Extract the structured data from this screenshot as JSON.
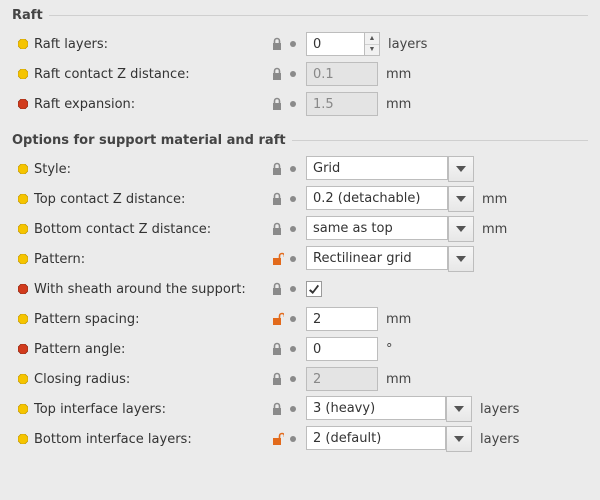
{
  "raft": {
    "title": "Raft",
    "rows": {
      "layers": {
        "label": "Raft layers:",
        "value": "0",
        "unit": "layers",
        "bullet": "yellow",
        "lock": "closed"
      },
      "contact_z": {
        "label": "Raft contact Z distance:",
        "value": "0.1",
        "unit": "mm",
        "bullet": "yellow",
        "lock": "closed",
        "disabled": true
      },
      "expansion": {
        "label": "Raft expansion:",
        "value": "1.5",
        "unit": "mm",
        "bullet": "red",
        "lock": "closed",
        "disabled": true
      }
    }
  },
  "opts": {
    "title": "Options for support material and raft",
    "rows": {
      "style": {
        "label": "Style:",
        "value": "Grid",
        "bullet": "yellow",
        "lock": "closed"
      },
      "top_contact": {
        "label": "Top contact Z distance:",
        "value": "0.2 (detachable)",
        "unit": "mm",
        "bullet": "yellow",
        "lock": "closed"
      },
      "bot_contact": {
        "label": "Bottom contact Z distance:",
        "value": "same as top",
        "unit": "mm",
        "bullet": "yellow",
        "lock": "closed"
      },
      "pattern": {
        "label": "Pattern:",
        "value": "Rectilinear grid",
        "bullet": "yellow",
        "lock": "open"
      },
      "sheath": {
        "label": "With sheath around the support:",
        "checked": true,
        "bullet": "red",
        "lock": "closed"
      },
      "spacing": {
        "label": "Pattern spacing:",
        "value": "2",
        "unit": "mm",
        "bullet": "yellow",
        "lock": "open"
      },
      "angle": {
        "label": "Pattern angle:",
        "value": "0",
        "unit": "°",
        "bullet": "red",
        "lock": "closed"
      },
      "closing": {
        "label": "Closing radius:",
        "value": "2",
        "unit": "mm",
        "bullet": "yellow",
        "lock": "closed",
        "disabled": true
      },
      "top_iface": {
        "label": "Top interface layers:",
        "value": "3 (heavy)",
        "unit": "layers",
        "bullet": "yellow",
        "lock": "closed"
      },
      "bot_iface": {
        "label": "Bottom interface layers:",
        "value": "2 (default)",
        "unit": "layers",
        "bullet": "yellow",
        "lock": "open"
      }
    }
  }
}
